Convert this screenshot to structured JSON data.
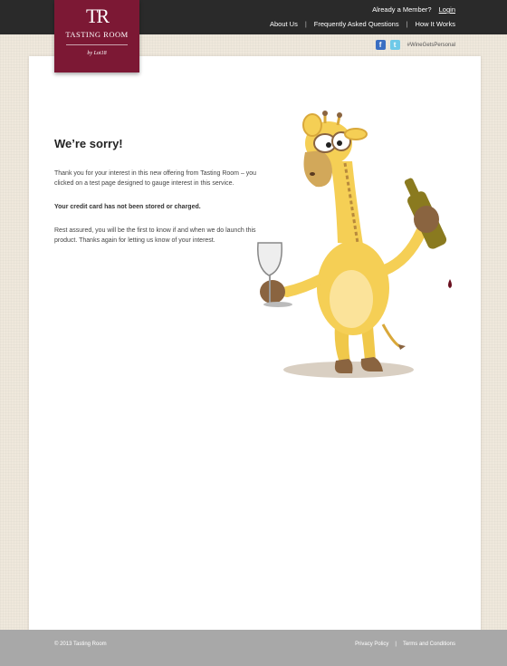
{
  "header": {
    "member_prompt": "Already a Member?",
    "login_label": "Login",
    "nav": [
      {
        "label": "About Us"
      },
      {
        "label": "Frequently Asked Questions"
      },
      {
        "label": "How It Works"
      }
    ],
    "nav_separator": "|"
  },
  "logo": {
    "monogram": "TR",
    "name": "TASTING ROOM",
    "byline": "by Lot18",
    "brand_color": "#7c1834"
  },
  "social": {
    "facebook_icon": "facebook-icon",
    "twitter_icon": "twitter-icon",
    "facebook_glyph": "f",
    "twitter_glyph": "t",
    "hashtag": "#WineGetsPersonal"
  },
  "main": {
    "title": "We’re sorry!",
    "paragraph1": "Thank you for your interest in this new offering from Tasting Room – you clicked on a test page designed to gauge interest in this service.",
    "paragraph2": "Your credit card has not been stored or charged.",
    "paragraph3": "Rest assured, you will be the first to know if and when we do launch this product. Thanks again for letting us know of your interest."
  },
  "footer": {
    "copyright": "© 2013 Tasting Room",
    "links": [
      {
        "label": "Privacy Policy"
      },
      {
        "label": "Terms and Conditions"
      }
    ],
    "separator": "|"
  },
  "colors": {
    "topbar": "#2a2a2a",
    "footer": "#a8a8a8",
    "background": "#efe8dc"
  }
}
